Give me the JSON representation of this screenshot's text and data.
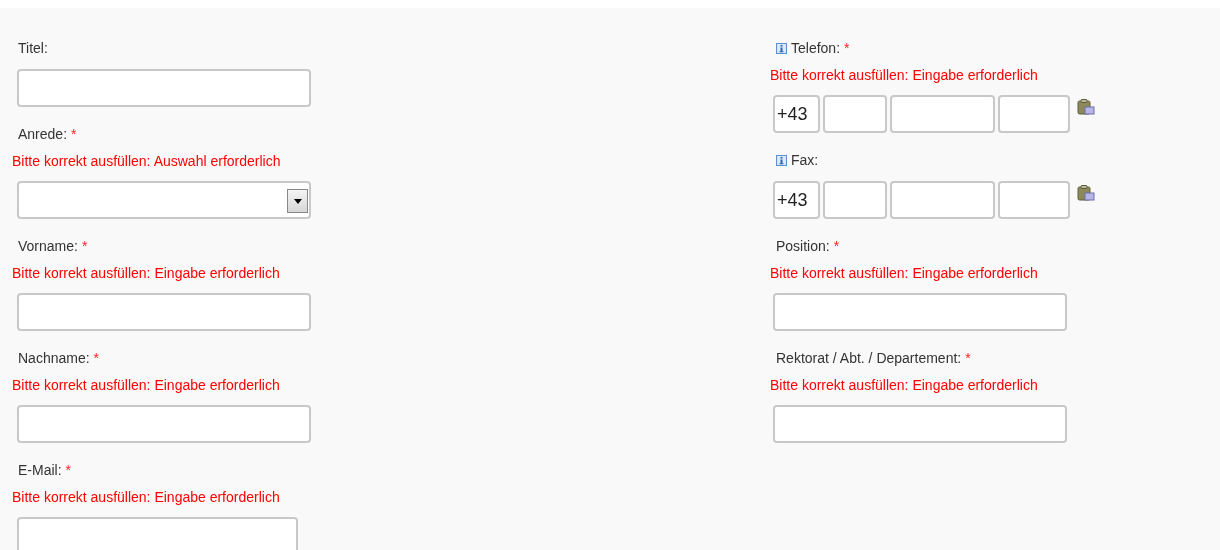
{
  "columns": [
    {
      "fields": [
        {
          "kind": "text",
          "label": "Titel:"
        },
        {
          "kind": "select",
          "label": "Anrede:",
          "required_mark": "*",
          "error": "Bitte korrekt ausfüllen: Auswahl erforderlich"
        },
        {
          "kind": "text",
          "label": "Vorname:",
          "required_mark": "*",
          "error": "Bitte korrekt ausfüllen: Eingabe erforderlich"
        },
        {
          "kind": "text",
          "label": "Nachname:",
          "required_mark": "*",
          "error": "Bitte korrekt ausfüllen: Eingabe erforderlich"
        },
        {
          "kind": "short",
          "label": "E-Mail:",
          "required_mark": "*",
          "error": "Bitte korrekt ausfüllen: Eingabe erforderlich"
        }
      ]
    },
    {
      "fields": [
        {
          "kind": "phone",
          "info": true,
          "label": "Telefon:",
          "required_mark": "*",
          "error": "Bitte korrekt ausfüllen: Eingabe erforderlich",
          "prefix": "+43"
        },
        {
          "kind": "phone",
          "info": true,
          "label": "Fax:",
          "prefix": "+43"
        },
        {
          "kind": "text",
          "label": "Position:",
          "required_mark": "*",
          "error": "Bitte korrekt ausfüllen: Eingabe erforderlich"
        },
        {
          "kind": "text",
          "label": "Rektorat / Abt. / Departement:",
          "required_mark": "*",
          "error": "Bitte korrekt ausfüllen: Eingabe erforderlich"
        }
      ]
    }
  ]
}
